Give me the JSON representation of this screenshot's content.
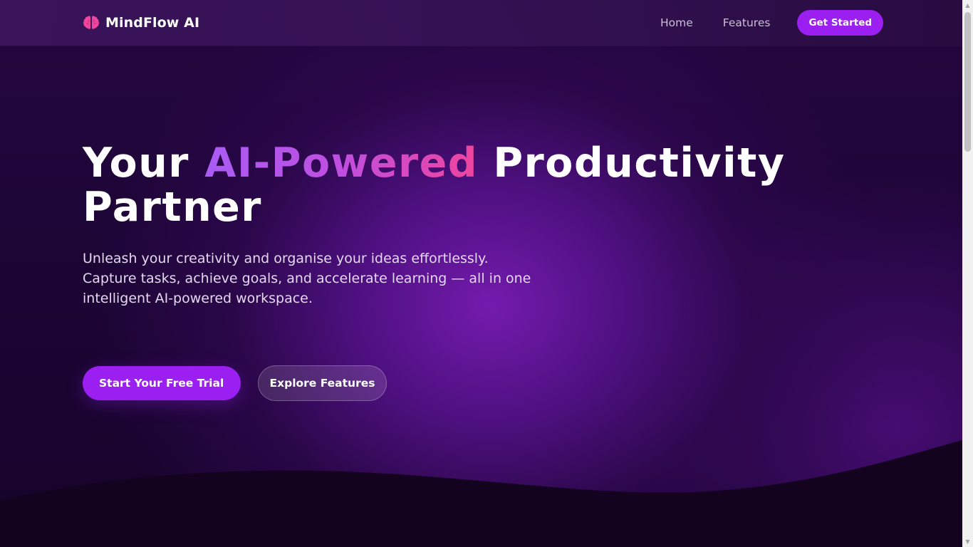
{
  "brand": {
    "name": "MindFlow AI",
    "icon": "brain-icon",
    "icon_color": "#f0459c"
  },
  "nav": {
    "links": [
      "Home",
      "Features"
    ],
    "cta_label": "Get Started"
  },
  "hero": {
    "title_before": "Your ",
    "title_highlight": "AI-Powered",
    "title_after": " Productivity Partner",
    "subtitle_lines": [
      "Unleash your creativity and organise your ideas effortlessly.",
      "Capture tasks, achieve goals, and accelerate learning — all in one",
      "intelligent AI-powered workspace."
    ],
    "primary_cta": "Start Your Free Trial",
    "secondary_cta": "Explore Features"
  },
  "colors": {
    "accent": "#9a1ff0",
    "highlight_start": "#a95cf5",
    "highlight_end": "#f0459c",
    "background": "#1d0536"
  },
  "scrollbar": {
    "up_icon": "arrow-up-icon",
    "down_icon": "arrow-down-icon"
  }
}
